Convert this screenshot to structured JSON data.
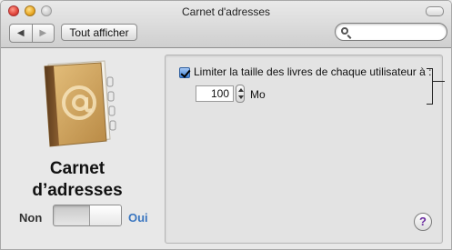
{
  "window": {
    "title": "Carnet  d'adresses"
  },
  "toolbar": {
    "back_icon": "chevron-left-icon",
    "forward_icon": "chevron-right-icon",
    "show_all_label": "Tout afficher",
    "search": {
      "value": "",
      "placeholder": "",
      "icon": "search-icon"
    }
  },
  "app": {
    "name_line1": "Carnet",
    "name_line2": "d’adresses",
    "icon": "address-book-icon"
  },
  "service_toggle": {
    "off_label": "Non",
    "on_label": "Oui",
    "state": "on",
    "on_color": "#3a76c0"
  },
  "settings": {
    "limit_checkbox_label": "Limiter la taille des livres de chaque utilisateur à :",
    "limit_checked": true,
    "limit_value": "100",
    "limit_unit": "Mo"
  },
  "help": {
    "label": "?",
    "color": "#6b2ca0"
  }
}
